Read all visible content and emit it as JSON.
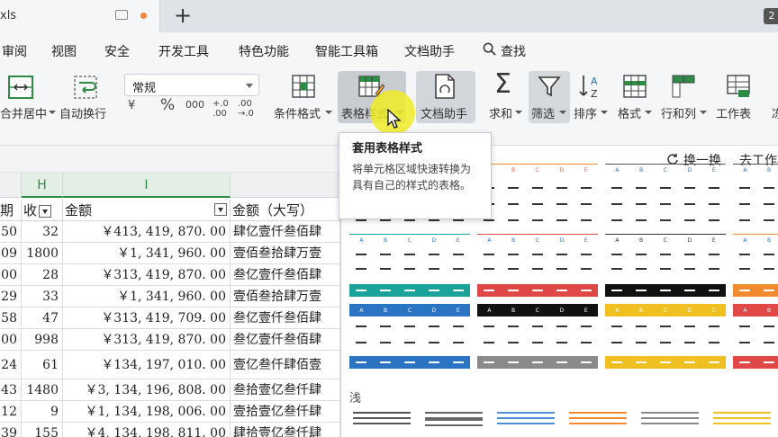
{
  "tab": {
    "name": "xls",
    "new_tab_symbol": "+"
  },
  "badge": "2",
  "menu": [
    {
      "label": "审阅"
    },
    {
      "label": "视图"
    },
    {
      "label": "安全"
    },
    {
      "label": "开发工具"
    },
    {
      "label": "特色功能"
    },
    {
      "label": "智能工具箱"
    },
    {
      "label": "文档助手"
    },
    {
      "label": "查找"
    }
  ],
  "ribbon": {
    "merge": "合并居中",
    "wrap": "自动换行",
    "number_format": "常规",
    "fmt_symbols": [
      "¥",
      "%",
      "000",
      "+.0 .00",
      ".00 →.0"
    ],
    "conditional": "条件格式",
    "table_style": "表格样式",
    "doc_helper": "文档助手",
    "sum": "求和",
    "filter": "筛选",
    "sort": "排序",
    "format": "格式",
    "rowcol": "行和列",
    "worksheet": "工作表",
    "cut_label": "冻"
  },
  "tooltip": {
    "title": "套用表格样式",
    "body": "将单元格区域快速转换为具有自己的样式的表格。"
  },
  "panel": {
    "swap": "换一换",
    "to_sheet": "去工作表",
    "section_light": "浅"
  },
  "sheet": {
    "columns": [
      {
        "label": ""
      },
      {
        "label": "H"
      },
      {
        "label": "I"
      },
      {
        "label": ""
      }
    ],
    "headers": {
      "a": "期",
      "h": "收",
      "i": "金额",
      "j": "金额（大写）"
    },
    "rows": [
      {
        "a": "50",
        "h": "32",
        "i": "￥413, 419, 870. 00",
        "j": "肆亿壹仟叁佰肆"
      },
      {
        "a": "09",
        "h": "1800",
        "i": "￥1, 341, 960. 00",
        "j": "壹佰叁拾肆万壹"
      },
      {
        "a": "00",
        "h": "28",
        "i": "￥313, 419, 870. 00",
        "j": "叁亿壹仟叁佰肆"
      },
      {
        "a": "29",
        "h": "33",
        "i": "￥1, 341, 960. 00",
        "j": "壹佰叁拾肆万壹"
      },
      {
        "a": "58",
        "h": "47",
        "i": "￥313, 419, 709. 00",
        "j": "叁亿壹仟叁佰肆"
      },
      {
        "a": "00",
        "h": "998",
        "i": "￥313, 419, 870. 00",
        "j": "叁亿壹仟叁佰肆"
      },
      {
        "a": "24",
        "h": "61",
        "i": "￥134, 197, 010. 00",
        "j": "壹亿叁仟肆佰壹"
      },
      {
        "a": "43",
        "h": "1480",
        "i": "￥3, 134, 196, 808. 00",
        "j": "叁拾壹亿叁仟肆"
      },
      {
        "a": "12",
        "h": "9",
        "i": "￥1, 134, 198, 006. 00",
        "j": "壹拾壹亿叁仟肆"
      },
      {
        "a": "39",
        "h": "155",
        "i": "￥4, 134, 198, 811. 00",
        "j": "肆拾壹亿叁仟肆"
      }
    ]
  },
  "colors": {
    "teal": "#1aa39a",
    "red": "#e04848",
    "black": "#111111",
    "orange": "#f28a30",
    "blue": "#2b74c4",
    "gray": "#8a8a8a",
    "yellow": "#f0c020",
    "green": "#2e8b45"
  }
}
